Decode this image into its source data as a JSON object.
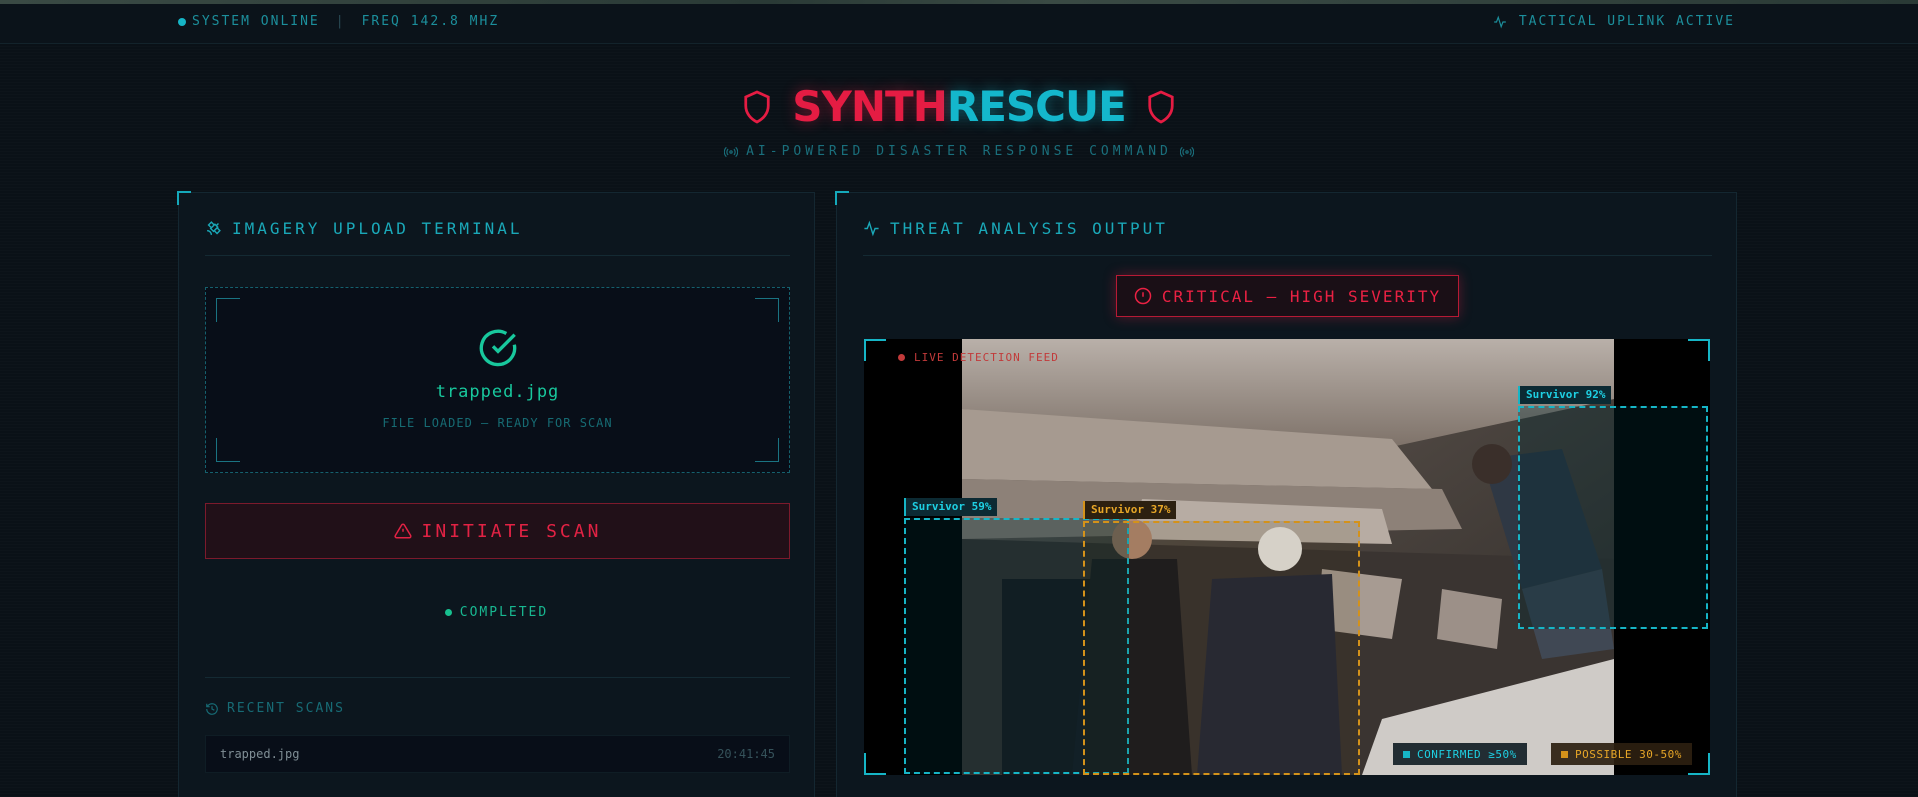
{
  "status": {
    "system": "SYSTEM ONLINE",
    "separator": "|",
    "freq": "FREQ 142.8 MHZ",
    "uplink": "TACTICAL UPLINK ACTIVE"
  },
  "brand": {
    "part1": "SYNTH",
    "part2": "RESCUE",
    "subtitle": "AI-POWERED DISASTER RESPONSE COMMAND",
    "accent_red": "#e51c43",
    "accent_cyan": "#14b7cc"
  },
  "upload_panel": {
    "title": "IMAGERY UPLOAD TERMINAL",
    "file_name": "trapped.jpg",
    "file_status": "FILE LOADED — READY FOR SCAN",
    "scan_button": "INITIATE SCAN",
    "scan_state": "COMPLETED",
    "recent_title": "RECENT SCANS",
    "recent": [
      {
        "name": "trapped.jpg",
        "time": "20:41:45"
      }
    ]
  },
  "analysis_panel": {
    "title": "THREAT ANALYSIS OUTPUT",
    "severity": "CRITICAL — HIGH SEVERITY",
    "live_label": "LIVE DETECTION FEED",
    "detections": [
      {
        "label": "Survivor 92%",
        "class": "confirmed"
      },
      {
        "label": "Survivor 59%",
        "class": "confirmed"
      },
      {
        "label": "Survivor 37%",
        "class": "possible"
      }
    ],
    "legend": {
      "confirmed": "CONFIRMED ≥50%",
      "possible": "POSSIBLE 30-50%"
    }
  },
  "icons": [
    "broadcast-dot-icon",
    "pulse-icon",
    "shield-icon",
    "radio-waves-icon",
    "satellite-icon",
    "check-circle-icon",
    "warning-triangle-icon",
    "history-icon",
    "alert-circle-icon"
  ]
}
